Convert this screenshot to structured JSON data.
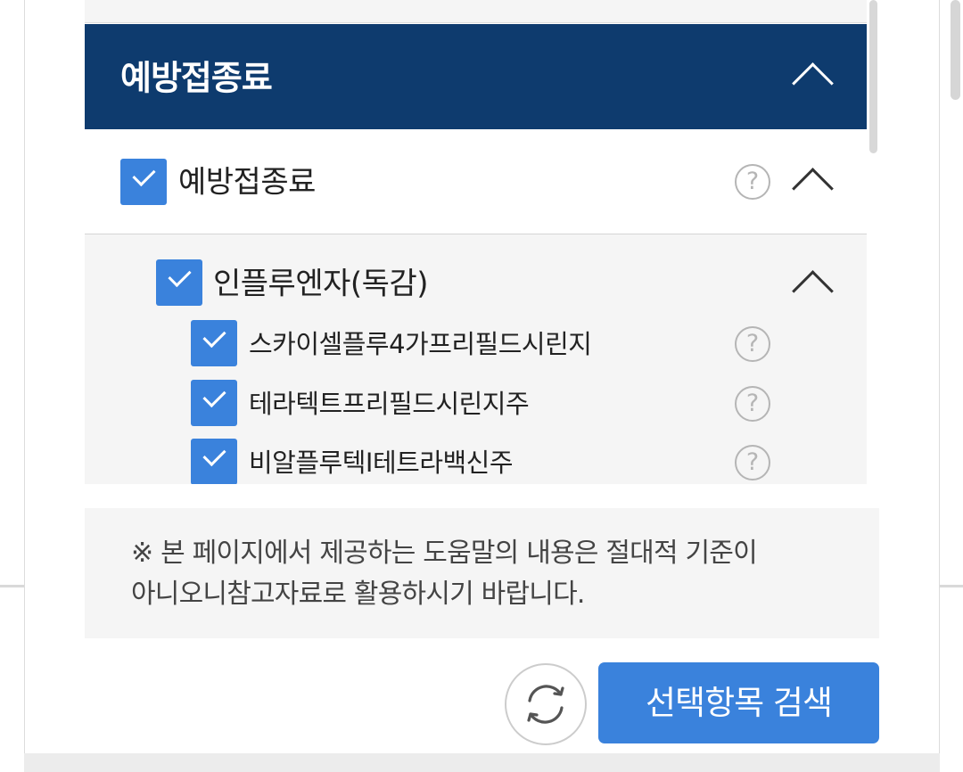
{
  "section": {
    "title": "예방접종료"
  },
  "category": {
    "label": "예방접종료",
    "checked": true
  },
  "subcategory": {
    "label": "인플루엔자(독감)",
    "checked": true
  },
  "items": [
    {
      "label": "스카이셀플루4가프리필드시린지",
      "checked": true
    },
    {
      "label": "테라텍트프리필드시린지주",
      "checked": true
    },
    {
      "label": "비알플루텍I테트라백신주",
      "checked": true
    }
  ],
  "help_glyph": "?",
  "notice": {
    "line1": "※ 본 페이지에서 제공하는 도움말의 내용은 절대적 기준이",
    "line2": "아니오니참고자료로 활용하시기 바랍니다."
  },
  "buttons": {
    "search_label": "선택항목 검색"
  },
  "icons": {
    "refresh": "refresh-icon",
    "collapse": "chevron-up-icon",
    "help": "help-circle-icon",
    "check": "check-icon"
  },
  "colors": {
    "header_bg": "#0e3b6e",
    "accent": "#3a82dc",
    "notice_bg": "#f5f5f5"
  }
}
